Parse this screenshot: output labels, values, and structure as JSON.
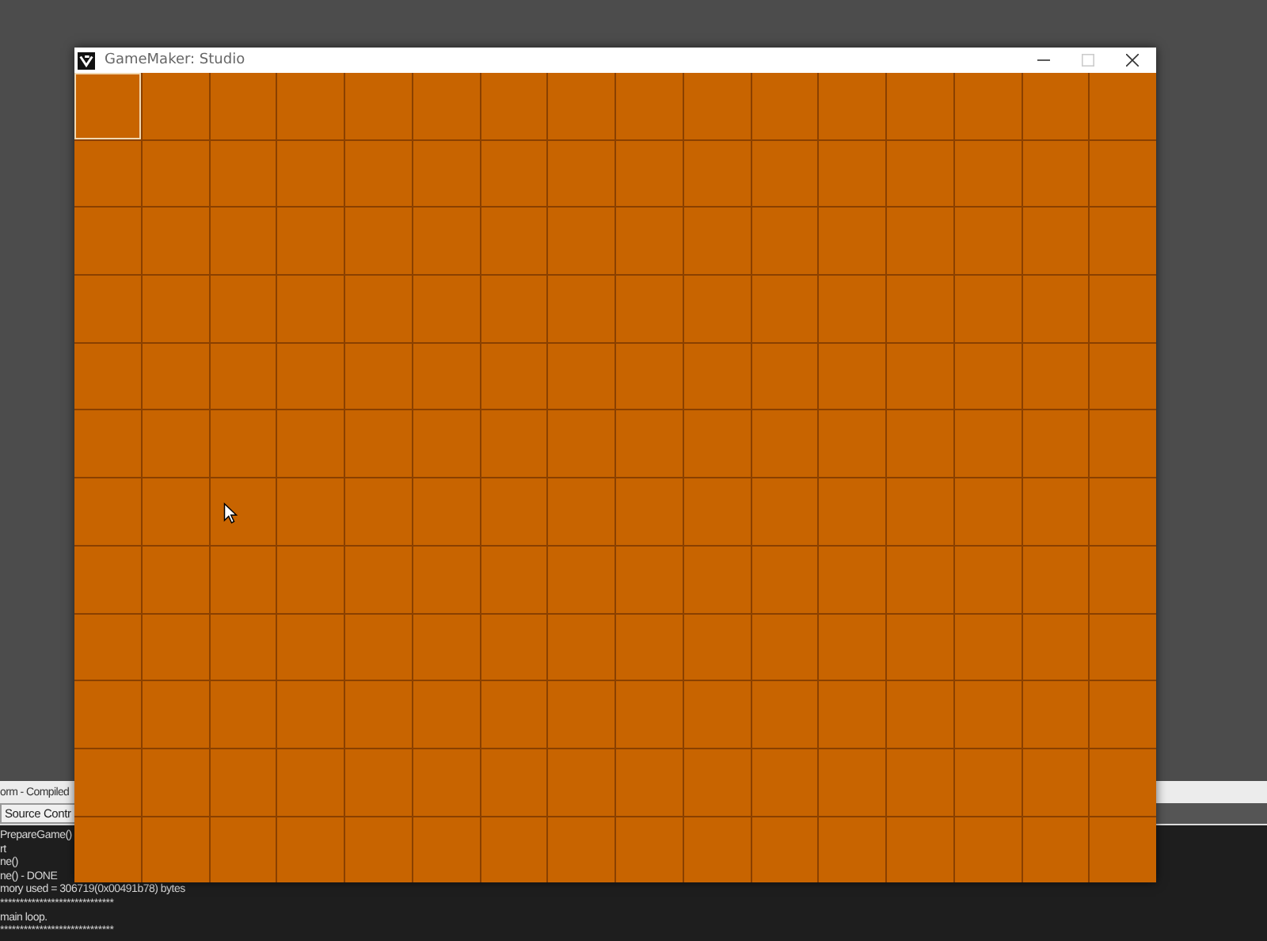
{
  "output_panel": {
    "title": "orm - Compiled",
    "tabs": [
      {
        "label": "Source Contr",
        "selected": true
      }
    ],
    "lines": [
      "PrepareGame()",
      "rt",
      "ne()",
      "ne() - DONE",
      "mory used = 306719(0x00491b78) bytes",
      "*****************************",
      "main loop.",
      "*****************************"
    ]
  },
  "game_window": {
    "title": "GameMaker: Studio",
    "board": [
      {
        "cells": [
          {
            "selected": true
          },
          {
            "selected": false
          },
          {
            "selected": false
          },
          {
            "selected": false
          },
          {
            "selected": false
          },
          {
            "selected": false
          },
          {
            "selected": false
          },
          {
            "selected": false
          },
          {
            "selected": false
          },
          {
            "selected": false
          },
          {
            "selected": false
          },
          {
            "selected": false
          },
          {
            "selected": false
          },
          {
            "selected": false
          },
          {
            "selected": false
          },
          {
            "selected": false
          }
        ]
      },
      {
        "cells": [
          {
            "selected": false
          },
          {
            "selected": false
          },
          {
            "selected": false
          },
          {
            "selected": false
          },
          {
            "selected": false
          },
          {
            "selected": false
          },
          {
            "selected": false
          },
          {
            "selected": false
          },
          {
            "selected": false
          },
          {
            "selected": false
          },
          {
            "selected": false
          },
          {
            "selected": false
          },
          {
            "selected": false
          },
          {
            "selected": false
          },
          {
            "selected": false
          },
          {
            "selected": false
          }
        ]
      },
      {
        "cells": [
          {
            "selected": false
          },
          {
            "selected": false
          },
          {
            "selected": false
          },
          {
            "selected": false
          },
          {
            "selected": false
          },
          {
            "selected": false
          },
          {
            "selected": false
          },
          {
            "selected": false
          },
          {
            "selected": false
          },
          {
            "selected": false
          },
          {
            "selected": false
          },
          {
            "selected": false
          },
          {
            "selected": false
          },
          {
            "selected": false
          },
          {
            "selected": false
          },
          {
            "selected": false
          }
        ]
      },
      {
        "cells": [
          {
            "selected": false
          },
          {
            "selected": false
          },
          {
            "selected": false
          },
          {
            "selected": false
          },
          {
            "selected": false
          },
          {
            "selected": false
          },
          {
            "selected": false
          },
          {
            "selected": false
          },
          {
            "selected": false
          },
          {
            "selected": false
          },
          {
            "selected": false
          },
          {
            "selected": false
          },
          {
            "selected": false
          },
          {
            "selected": false
          },
          {
            "selected": false
          },
          {
            "selected": false
          }
        ]
      },
      {
        "cells": [
          {
            "selected": false
          },
          {
            "selected": false
          },
          {
            "selected": false
          },
          {
            "selected": false
          },
          {
            "selected": false
          },
          {
            "selected": false
          },
          {
            "selected": false
          },
          {
            "selected": false
          },
          {
            "selected": false
          },
          {
            "selected": false
          },
          {
            "selected": false
          },
          {
            "selected": false
          },
          {
            "selected": false
          },
          {
            "selected": false
          },
          {
            "selected": false
          },
          {
            "selected": false
          }
        ]
      },
      {
        "cells": [
          {
            "selected": false
          },
          {
            "selected": false
          },
          {
            "selected": false
          },
          {
            "selected": false
          },
          {
            "selected": false
          },
          {
            "selected": false
          },
          {
            "selected": false
          },
          {
            "selected": false
          },
          {
            "selected": false
          },
          {
            "selected": false
          },
          {
            "selected": false
          },
          {
            "selected": false
          },
          {
            "selected": false
          },
          {
            "selected": false
          },
          {
            "selected": false
          },
          {
            "selected": false
          }
        ]
      },
      {
        "cells": [
          {
            "selected": false
          },
          {
            "selected": false
          },
          {
            "selected": false
          },
          {
            "selected": false
          },
          {
            "selected": false
          },
          {
            "selected": false
          },
          {
            "selected": false
          },
          {
            "selected": false
          },
          {
            "selected": false
          },
          {
            "selected": false
          },
          {
            "selected": false
          },
          {
            "selected": false
          },
          {
            "selected": false
          },
          {
            "selected": false
          },
          {
            "selected": false
          },
          {
            "selected": false
          }
        ]
      },
      {
        "cells": [
          {
            "selected": false
          },
          {
            "selected": false
          },
          {
            "selected": false
          },
          {
            "selected": false
          },
          {
            "selected": false
          },
          {
            "selected": false
          },
          {
            "selected": false
          },
          {
            "selected": false
          },
          {
            "selected": false
          },
          {
            "selected": false
          },
          {
            "selected": false
          },
          {
            "selected": false
          },
          {
            "selected": false
          },
          {
            "selected": false
          },
          {
            "selected": false
          },
          {
            "selected": false
          }
        ]
      },
      {
        "cells": [
          {
            "selected": false
          },
          {
            "selected": false
          },
          {
            "selected": false
          },
          {
            "selected": false
          },
          {
            "selected": false
          },
          {
            "selected": false
          },
          {
            "selected": false
          },
          {
            "selected": false
          },
          {
            "selected": false
          },
          {
            "selected": false
          },
          {
            "selected": false
          },
          {
            "selected": false
          },
          {
            "selected": false
          },
          {
            "selected": false
          },
          {
            "selected": false
          },
          {
            "selected": false
          }
        ]
      },
      {
        "cells": [
          {
            "selected": false
          },
          {
            "selected": false
          },
          {
            "selected": false
          },
          {
            "selected": false
          },
          {
            "selected": false
          },
          {
            "selected": false
          },
          {
            "selected": false
          },
          {
            "selected": false
          },
          {
            "selected": false
          },
          {
            "selected": false
          },
          {
            "selected": false
          },
          {
            "selected": false
          },
          {
            "selected": false
          },
          {
            "selected": false
          },
          {
            "selected": false
          },
          {
            "selected": false
          }
        ]
      },
      {
        "cells": [
          {
            "selected": false
          },
          {
            "selected": false
          },
          {
            "selected": false
          },
          {
            "selected": false
          },
          {
            "selected": false
          },
          {
            "selected": false
          },
          {
            "selected": false
          },
          {
            "selected": false
          },
          {
            "selected": false
          },
          {
            "selected": false
          },
          {
            "selected": false
          },
          {
            "selected": false
          },
          {
            "selected": false
          },
          {
            "selected": false
          },
          {
            "selected": false
          },
          {
            "selected": false
          }
        ]
      },
      {
        "cells": [
          {
            "selected": false
          },
          {
            "selected": false
          },
          {
            "selected": false
          },
          {
            "selected": false
          },
          {
            "selected": false
          },
          {
            "selected": false
          },
          {
            "selected": false
          },
          {
            "selected": false
          },
          {
            "selected": false
          },
          {
            "selected": false
          },
          {
            "selected": false
          },
          {
            "selected": false
          },
          {
            "selected": false
          },
          {
            "selected": false
          },
          {
            "selected": false
          },
          {
            "selected": false
          }
        ]
      }
    ]
  }
}
